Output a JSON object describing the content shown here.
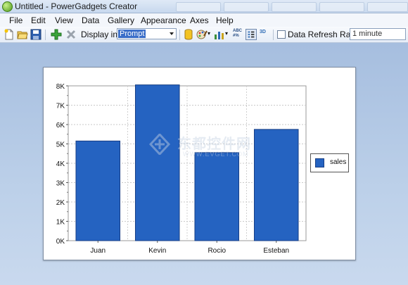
{
  "window": {
    "title": "Untitled - PowerGadgets Creator"
  },
  "menu": [
    "File",
    "Edit",
    "View",
    "Data",
    "Gallery",
    "Appearance",
    "Axes",
    "Help"
  ],
  "toolbar": {
    "display_label": "Display in:",
    "display_value": "Prompt",
    "refresh_label": "Data Refresh Rate:",
    "refresh_value": "1 minute",
    "format_icon_text": "ABC #%",
    "view_3d_text": "3D"
  },
  "watermark": {
    "name": "东都控件网",
    "url": "WWW.EVGET.COM"
  },
  "legend": {
    "label": "sales",
    "color": "#2563c1"
  },
  "colors": {
    "bar": "#2563c1",
    "bar_border": "#163e85"
  },
  "chart_data": {
    "type": "bar",
    "categories": [
      "Juan",
      "Kevin",
      "Rocio",
      "Esteban"
    ],
    "series": [
      {
        "name": "sales",
        "values": [
          5150,
          8050,
          4550,
          5750
        ]
      }
    ],
    "ylim": [
      0,
      8000
    ],
    "yticks": [
      "0K",
      "1K",
      "2K",
      "3K",
      "4K",
      "5K",
      "6K",
      "7K",
      "8K"
    ],
    "grid": true,
    "legend_position": "right"
  }
}
